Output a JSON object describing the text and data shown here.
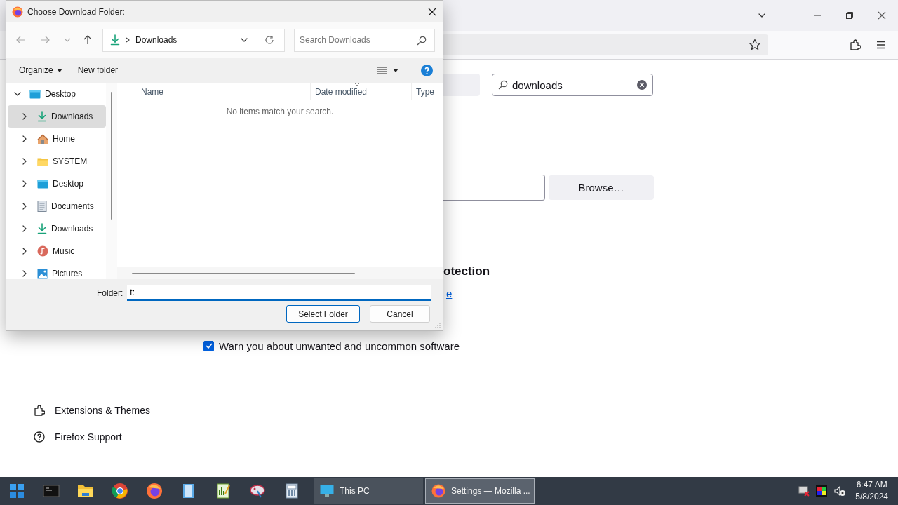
{
  "browser": {
    "search": {
      "value": "downloads"
    },
    "browse_button": "Browse…",
    "section_heading": "otection",
    "link": "e",
    "checkbox": {
      "label": "Warn you about unwanted and uncommon software",
      "checked": true
    },
    "sidebar": {
      "items": [
        "Extensions & Themes",
        "Firefox Support"
      ]
    }
  },
  "dialog": {
    "title": "Choose Download Folder:",
    "address": {
      "crumb": "Downloads"
    },
    "search": {
      "placeholder": "Search Downloads"
    },
    "commands": [
      "Organize",
      "New folder"
    ],
    "tree": [
      {
        "label": "Desktop",
        "kind": "desktop",
        "expanded": true,
        "selected": false,
        "children": [
          {
            "label": "Downloads",
            "kind": "downloads",
            "expanded": false,
            "selected": true
          },
          {
            "label": "Home",
            "kind": "home",
            "expanded": false,
            "selected": false
          },
          {
            "label": "SYSTEM",
            "kind": "folder",
            "expanded": false,
            "selected": false
          },
          {
            "label": "Desktop",
            "kind": "desktop",
            "expanded": false,
            "selected": false
          },
          {
            "label": "Documents",
            "kind": "documents",
            "expanded": false,
            "selected": false
          },
          {
            "label": "Downloads",
            "kind": "downloads",
            "expanded": false,
            "selected": false
          },
          {
            "label": "Music",
            "kind": "music",
            "expanded": false,
            "selected": false
          },
          {
            "label": "Pictures",
            "kind": "pictures",
            "expanded": false,
            "selected": false
          }
        ]
      }
    ],
    "columns": [
      "Name",
      "Date modified",
      "Type"
    ],
    "empty_message": "No items match your search.",
    "folder": {
      "label": "Folder:",
      "value": "t:"
    },
    "buttons": [
      {
        "label": "Select Folder",
        "kind": "default"
      },
      {
        "label": "Cancel",
        "kind": "normal"
      }
    ]
  },
  "taskbar": {
    "tasks": [
      {
        "label": "This PC",
        "kind": "monitor",
        "selected": false
      },
      {
        "label": "Settings — Mozilla ...",
        "kind": "firefox",
        "selected": true
      }
    ],
    "clock": {
      "time": "6:47 AM",
      "date": "5/8/2024"
    }
  }
}
